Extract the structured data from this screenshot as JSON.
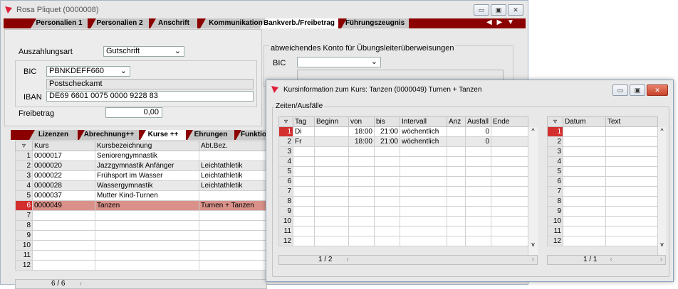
{
  "main_window": {
    "title": "Rosa Pliquet (0000008)",
    "tabs": [
      "Personalien 1",
      "Personalien 2",
      "Anschrift",
      "Kommunikation",
      "Bankverb./Freibetrag",
      "Führungszeugnis"
    ],
    "active_tab": "Bankverb./Freibetrag"
  },
  "bank": {
    "auszahlungsart_label": "Auszahlungsart",
    "auszahlungsart_value": "Gutschrift",
    "bic_label": "BIC",
    "bic_value": "PBNKDEFF660",
    "bank_name": "Postscheckamt",
    "iban_label": "IBAN",
    "iban_value": "DE69 6601 0075 0000 9228 83",
    "freibetrag_label": "Freibetrag",
    "freibetrag_value": "0,00",
    "alt_account_title": "abweichendes Konto für Übungsleiterüberweisungen",
    "alt_bic_label": "BIC"
  },
  "lower_tabs": [
    "Lizenzen",
    "Abrechnung++",
    "Kurse ++",
    "Ehrungen",
    "Funktio"
  ],
  "lower_active_tab": "Kurse ++",
  "courses": {
    "headers": [
      "Kurs",
      "Kursbezeichnung",
      "Abt.Bez."
    ],
    "rows": [
      {
        "n": "1",
        "kurs": "0000017",
        "bez": "Seniorengymnastik",
        "abt": ""
      },
      {
        "n": "2",
        "kurs": "0000020",
        "bez": "Jazzgymnastik Anfänger",
        "abt": "Leichtathletik"
      },
      {
        "n": "3",
        "kurs": "0000022",
        "bez": "Frühsport im Wasser",
        "abt": "Leichtathletik"
      },
      {
        "n": "4",
        "kurs": "0000028",
        "bez": "Wassergymnastik",
        "abt": "Leichtathletik"
      },
      {
        "n": "5",
        "kurs": "0000037",
        "bez": "Mutter Kind-Turnen",
        "abt": ""
      },
      {
        "n": "6",
        "kurs": "0000049",
        "bez": "Tanzen",
        "abt": "Turnen + Tanzen"
      },
      {
        "n": "7",
        "kurs": "",
        "bez": "",
        "abt": ""
      },
      {
        "n": "8",
        "kurs": "",
        "bez": "",
        "abt": ""
      },
      {
        "n": "9",
        "kurs": "",
        "bez": "",
        "abt": ""
      },
      {
        "n": "10",
        "kurs": "",
        "bez": "",
        "abt": ""
      },
      {
        "n": "11",
        "kurs": "",
        "bez": "",
        "abt": ""
      },
      {
        "n": "12",
        "kurs": "",
        "bez": "",
        "abt": ""
      }
    ],
    "pager": "6 / 6"
  },
  "popup": {
    "title": "Kursinformation zum Kurs: Tanzen (0000049) Turnen + Tanzen",
    "group_label": "Zeiten/Ausfälle",
    "times_headers": [
      "Tag",
      "Beginn",
      "von",
      "bis",
      "Intervall",
      "Anz",
      "Ausfall",
      "Ende"
    ],
    "times_rows": [
      {
        "n": "1",
        "tag": "Di",
        "beginn": "",
        "von": "18:00",
        "bis": "21:00",
        "intervall": "wöchentlich",
        "anz": "",
        "ausfall": "0",
        "ende": ""
      },
      {
        "n": "2",
        "tag": "Fr",
        "beginn": "",
        "von": "18:00",
        "bis": "21:00",
        "intervall": "wöchentlich",
        "anz": "",
        "ausfall": "0",
        "ende": ""
      },
      {
        "n": "3"
      },
      {
        "n": "4"
      },
      {
        "n": "5"
      },
      {
        "n": "6"
      },
      {
        "n": "7"
      },
      {
        "n": "8"
      },
      {
        "n": "9"
      },
      {
        "n": "10"
      },
      {
        "n": "11"
      },
      {
        "n": "12"
      }
    ],
    "times_pager": "1 / 2",
    "dates_headers": [
      "Datum",
      "Text"
    ],
    "dates_rows": [
      "1",
      "2",
      "3",
      "4",
      "5",
      "6",
      "7",
      "8",
      "9",
      "10",
      "11",
      "12"
    ],
    "dates_pager": "1 / 1"
  },
  "colors": {
    "accent": "#d32f2f",
    "tabbar": "#8b0000",
    "selected_row": "#d9918a"
  }
}
